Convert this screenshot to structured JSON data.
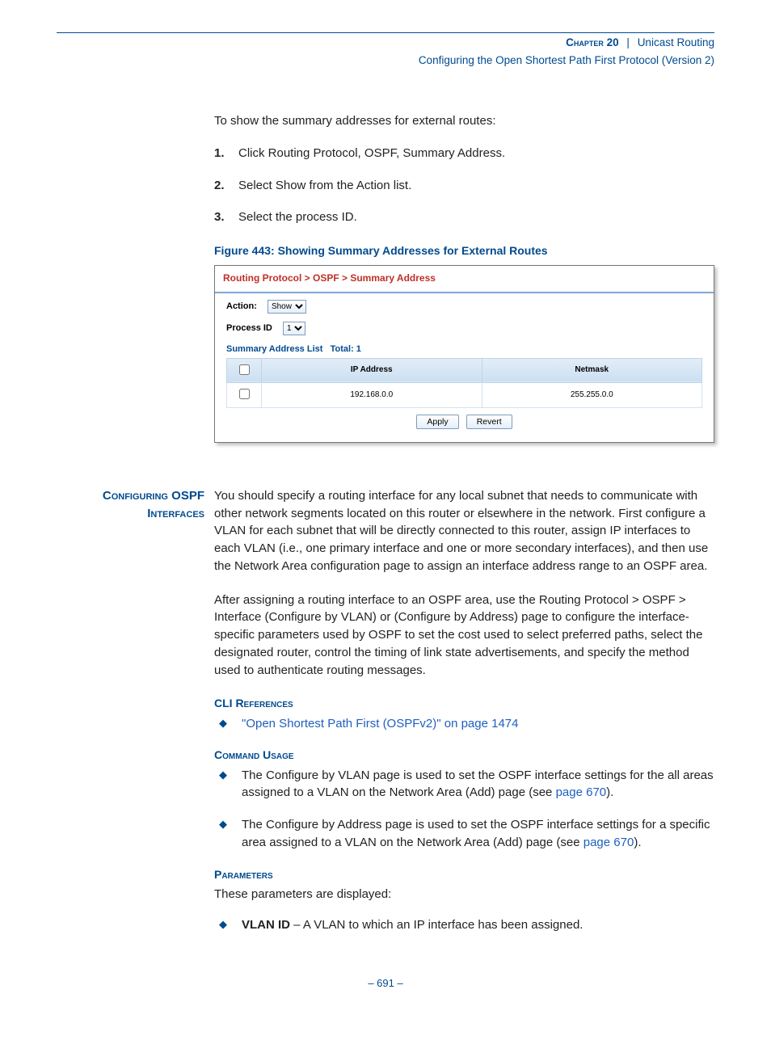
{
  "header": {
    "chapter_label": "Chapter 20",
    "chapter_title": "Unicast Routing",
    "subtitle": "Configuring the Open Shortest Path First Protocol (Version 2)"
  },
  "intro_line": "To show the summary addresses for external routes:",
  "steps": [
    {
      "num": "1.",
      "text": "Click Routing Protocol, OSPF, Summary Address."
    },
    {
      "num": "2.",
      "text": "Select Show from the Action list."
    },
    {
      "num": "3.",
      "text": "Select the process ID."
    }
  ],
  "figure_caption": "Figure 443:  Showing Summary Addresses for External Routes",
  "mock": {
    "breadcrumb": "Routing Protocol > OSPF > Summary Address",
    "action_label": "Action:",
    "action_value": "Show",
    "process_label": "Process ID",
    "process_value": "1",
    "list_title": "Summary Address List",
    "list_total_label": "Total:",
    "list_total_value": "1",
    "columns": [
      "IP Address",
      "Netmask"
    ],
    "rows": [
      {
        "ip": "192.168.0.0",
        "mask": "255.255.0.0"
      }
    ],
    "apply": "Apply",
    "revert": "Revert"
  },
  "section_heading": "Configuring OSPF Interfaces",
  "para1": "You should specify a routing interface for any local subnet that needs to communicate with other network segments located on this router or elsewhere in the network. First configure a VLAN for each subnet that will be directly connected to this router, assign IP interfaces to each VLAN (i.e., one primary interface and one or more secondary interfaces), and then use the Network Area configuration page to assign an interface address range to an OSPF area.",
  "para2": "After assigning a routing interface to an OSPF area, use the Routing Protocol > OSPF > Interface (Configure by VLAN) or (Configure by Address) page to configure the interface-specific parameters used by OSPF to set the cost used to select preferred paths, select the designated router, control the timing of link state advertisements, and specify the method used to authenticate routing messages.",
  "cli_heading": "CLI References",
  "cli_link": "\"Open Shortest Path First (OSPFv2)\" on page 1474",
  "usage_heading": "Command Usage",
  "usage_items": [
    {
      "pre": "The Configure by VLAN page is used to set the OSPF interface settings for the all areas assigned to a VLAN on the Network Area (Add) page (see ",
      "link": "page 670",
      "post": ")."
    },
    {
      "pre": "The Configure by Address page is used to set the OSPF interface settings for a specific area assigned to a VLAN on the Network Area (Add) page (see ",
      "link": "page 670",
      "post": ")."
    }
  ],
  "param_heading": "Parameters",
  "param_intro": "These parameters are displayed:",
  "param_item_name": "VLAN ID",
  "param_item_desc": " – A VLAN to which an IP interface has been assigned.",
  "page_number": "–  691  –"
}
